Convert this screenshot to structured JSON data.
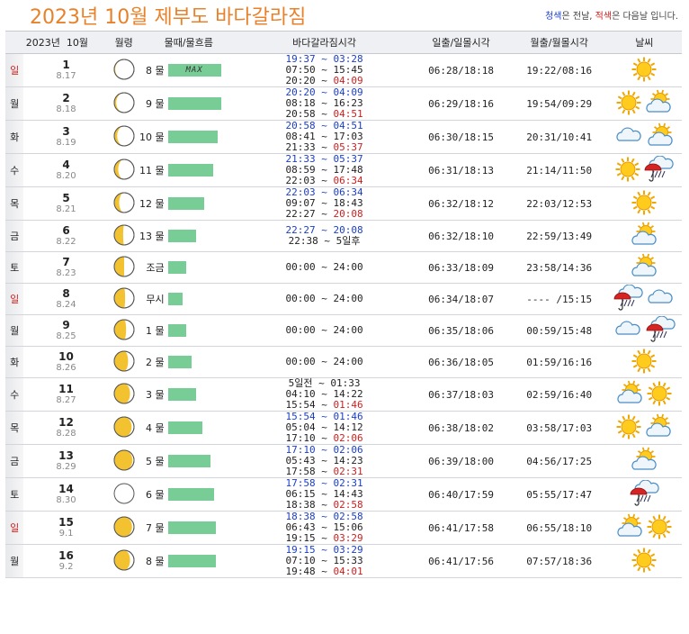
{
  "header": {
    "title": "2023년 10월 제부도 바다갈라짐",
    "legend_blue": "청색",
    "legend_mid": "은 전날, ",
    "legend_red": "적색",
    "legend_end": "은 다음날 입니다."
  },
  "columns": {
    "year": "2023년",
    "month": "10월",
    "lunar": "월령",
    "mul": "물때/물흐름",
    "tide": "바다갈라짐시각",
    "sun": "일출/일몰시각",
    "moon": "월출/월몰시각",
    "weather": "날씨"
  },
  "colors": {
    "bar": "#78cc96",
    "title": "#e8822a",
    "blue": "#1a3ec8",
    "red": "#cc1f1f"
  },
  "rows": [
    {
      "dow": "일",
      "sunday": true,
      "day": "1",
      "lunar": "8.17",
      "moon_phase": 0.95,
      "mul": "8 물",
      "level": 0.95,
      "max": "MAX",
      "tides": [
        {
          "t": "19:37 ~ 03:28",
          "prev": true
        },
        {
          "t": "07:50 ~ 15:45"
        },
        {
          "t": "20:20 ~ ",
          "n": "04:09"
        }
      ],
      "sun": "06:28/18:18",
      "moonrise": "19:22/08:16",
      "weather": [
        "sun"
      ]
    },
    {
      "dow": "월",
      "day": "2",
      "lunar": "8.18",
      "moon_phase": 0.9,
      "mul": "9 물",
      "level": 0.95,
      "tides": [
        {
          "t": "20:20 ~ 04:09",
          "prev": true
        },
        {
          "t": "08:18 ~ 16:23"
        },
        {
          "t": "20:58 ~ ",
          "n": "04:51"
        }
      ],
      "sun": "06:29/18:16",
      "moonrise": "19:54/09:29",
      "weather": [
        "sun",
        "cloudsun"
      ]
    },
    {
      "dow": "화",
      "day": "3",
      "lunar": "8.19",
      "moon_phase": 0.85,
      "mul": "10 물",
      "level": 0.88,
      "tides": [
        {
          "t": "20:58 ~ 04:51",
          "prev": true
        },
        {
          "t": "08:41 ~ 17:03"
        },
        {
          "t": "21:33 ~ ",
          "n": "05:37"
        }
      ],
      "sun": "06:30/18:15",
      "moonrise": "20:31/10:41",
      "weather": [
        "cloud",
        "cloudsun"
      ]
    },
    {
      "dow": "수",
      "day": "4",
      "lunar": "8.20",
      "moon_phase": 0.8,
      "mul": "11 물",
      "level": 0.8,
      "tides": [
        {
          "t": "21:33 ~ 05:37",
          "prev": true
        },
        {
          "t": "08:59 ~ 17:48"
        },
        {
          "t": "22:03 ~ ",
          "n": "06:34"
        }
      ],
      "sun": "06:31/18:13",
      "moonrise": "21:14/11:50",
      "weather": [
        "sun",
        "rainstorm"
      ]
    },
    {
      "dow": "목",
      "day": "5",
      "lunar": "8.21",
      "moon_phase": 0.75,
      "mul": "12 물",
      "level": 0.65,
      "tides": [
        {
          "t": "22:03 ~ 06:34",
          "prev": true
        },
        {
          "t": "09:07 ~ 18:43"
        },
        {
          "t": "22:27 ~ ",
          "n": "20:08"
        }
      ],
      "sun": "06:32/18:12",
      "moonrise": "22:03/12:53",
      "weather": [
        "sun"
      ]
    },
    {
      "dow": "금",
      "day": "6",
      "lunar": "8.22",
      "moon_phase": 0.55,
      "mul": "13 물",
      "level": 0.5,
      "tides": [
        {
          "t": "22:27 ~ 20:08",
          "prev": true
        },
        {
          "t": "22:38 ~ 5일후"
        }
      ],
      "sun": "06:32/18:10",
      "moonrise": "22:59/13:49",
      "weather": [
        "cloudsun"
      ]
    },
    {
      "dow": "토",
      "day": "7",
      "lunar": "8.23",
      "moon_phase": 0.5,
      "mul": "조금",
      "level": 0.33,
      "tides": [
        {
          "t": "00:00 ~ 24:00"
        }
      ],
      "sun": "06:33/18:09",
      "moonrise": "23:58/14:36",
      "weather": [
        "cloudsun"
      ]
    },
    {
      "dow": "일",
      "sunday": true,
      "day": "8",
      "lunar": "8.24",
      "moon_phase": 0.45,
      "mul": "무시",
      "level": 0.25,
      "tides": [
        {
          "t": "00:00 ~ 24:00"
        }
      ],
      "sun": "06:34/18:07",
      "moonrise": "---- /15:15",
      "weather": [
        "rainstorm",
        "cloud"
      ]
    },
    {
      "dow": "월",
      "day": "9",
      "lunar": "8.25",
      "moon_phase": 0.4,
      "mul": "1 물",
      "level": 0.33,
      "tides": [
        {
          "t": "00:00 ~ 24:00"
        }
      ],
      "sun": "06:35/18:06",
      "moonrise": "00:59/15:48",
      "weather": [
        "cloud",
        "rainstorm"
      ]
    },
    {
      "dow": "화",
      "day": "10",
      "lunar": "8.26",
      "moon_phase": 0.3,
      "mul": "2 물",
      "level": 0.42,
      "tides": [
        {
          "t": "00:00 ~ 24:00"
        }
      ],
      "sun": "06:36/18:05",
      "moonrise": "01:59/16:16",
      "weather": [
        "sun"
      ]
    },
    {
      "dow": "수",
      "day": "11",
      "lunar": "8.27",
      "moon_phase": 0.2,
      "mul": "3 물",
      "level": 0.5,
      "tides": [
        {
          "t": "5일전 ~ 01:33"
        },
        {
          "t": "04:10 ~ 14:22"
        },
        {
          "t": "15:54 ~ ",
          "n": "01:46"
        }
      ],
      "sun": "06:37/18:03",
      "moonrise": "02:59/16:40",
      "weather": [
        "cloudsun",
        "sun"
      ]
    },
    {
      "dow": "목",
      "day": "12",
      "lunar": "8.28",
      "moon_phase": 0.12,
      "mul": "4 물",
      "level": 0.62,
      "tides": [
        {
          "t": "15:54 ~ 01:46",
          "prev": true
        },
        {
          "t": "05:04 ~ 14:12"
        },
        {
          "t": "17:10 ~ ",
          "n": "02:06"
        }
      ],
      "sun": "06:38/18:02",
      "moonrise": "03:58/17:03",
      "weather": [
        "sun",
        "cloudsun"
      ]
    },
    {
      "dow": "금",
      "day": "13",
      "lunar": "8.29",
      "moon_phase": 0.08,
      "mul": "5 물",
      "level": 0.75,
      "tides": [
        {
          "t": "17:10 ~ 02:06",
          "prev": true
        },
        {
          "t": "05:43 ~ 14:23"
        },
        {
          "t": "17:58 ~ ",
          "n": "02:31"
        }
      ],
      "sun": "06:39/18:00",
      "moonrise": "04:56/17:25",
      "weather": [
        "cloudsun"
      ]
    },
    {
      "dow": "토",
      "day": "14",
      "lunar": "8.30",
      "moon_phase": 0.0,
      "mul": "6 물",
      "level": 0.83,
      "tides": [
        {
          "t": "17:58 ~ 02:31",
          "prev": true
        },
        {
          "t": "06:15 ~ 14:43"
        },
        {
          "t": "18:38 ~ ",
          "n": "02:58"
        }
      ],
      "sun": "06:40/17:59",
      "moonrise": "05:55/17:47",
      "weather": [
        "rainstorm"
      ]
    },
    {
      "dow": "일",
      "sunday": true,
      "day": "15",
      "lunar": "9.1",
      "moon_phase": 0.1,
      "mul": "7 물",
      "level": 0.85,
      "tides": [
        {
          "t": "18:38 ~ 02:58",
          "prev": true
        },
        {
          "t": "06:43 ~ 15:06"
        },
        {
          "t": "19:15 ~ ",
          "n": "03:29"
        }
      ],
      "sun": "06:41/17:58",
      "moonrise": "06:55/18:10",
      "weather": [
        "cloudsun",
        "sun"
      ]
    },
    {
      "dow": "월",
      "day": "16",
      "lunar": "9.2",
      "moon_phase": 0.2,
      "mul": "8 물",
      "level": 0.85,
      "tides": [
        {
          "t": "19:15 ~ 03:29",
          "prev": true
        },
        {
          "t": "07:10 ~ 15:33"
        },
        {
          "t": "19:48 ~ ",
          "n": "04:01"
        }
      ],
      "sun": "06:41/17:56",
      "moonrise": "07:57/18:36",
      "weather": [
        "sun"
      ]
    }
  ]
}
